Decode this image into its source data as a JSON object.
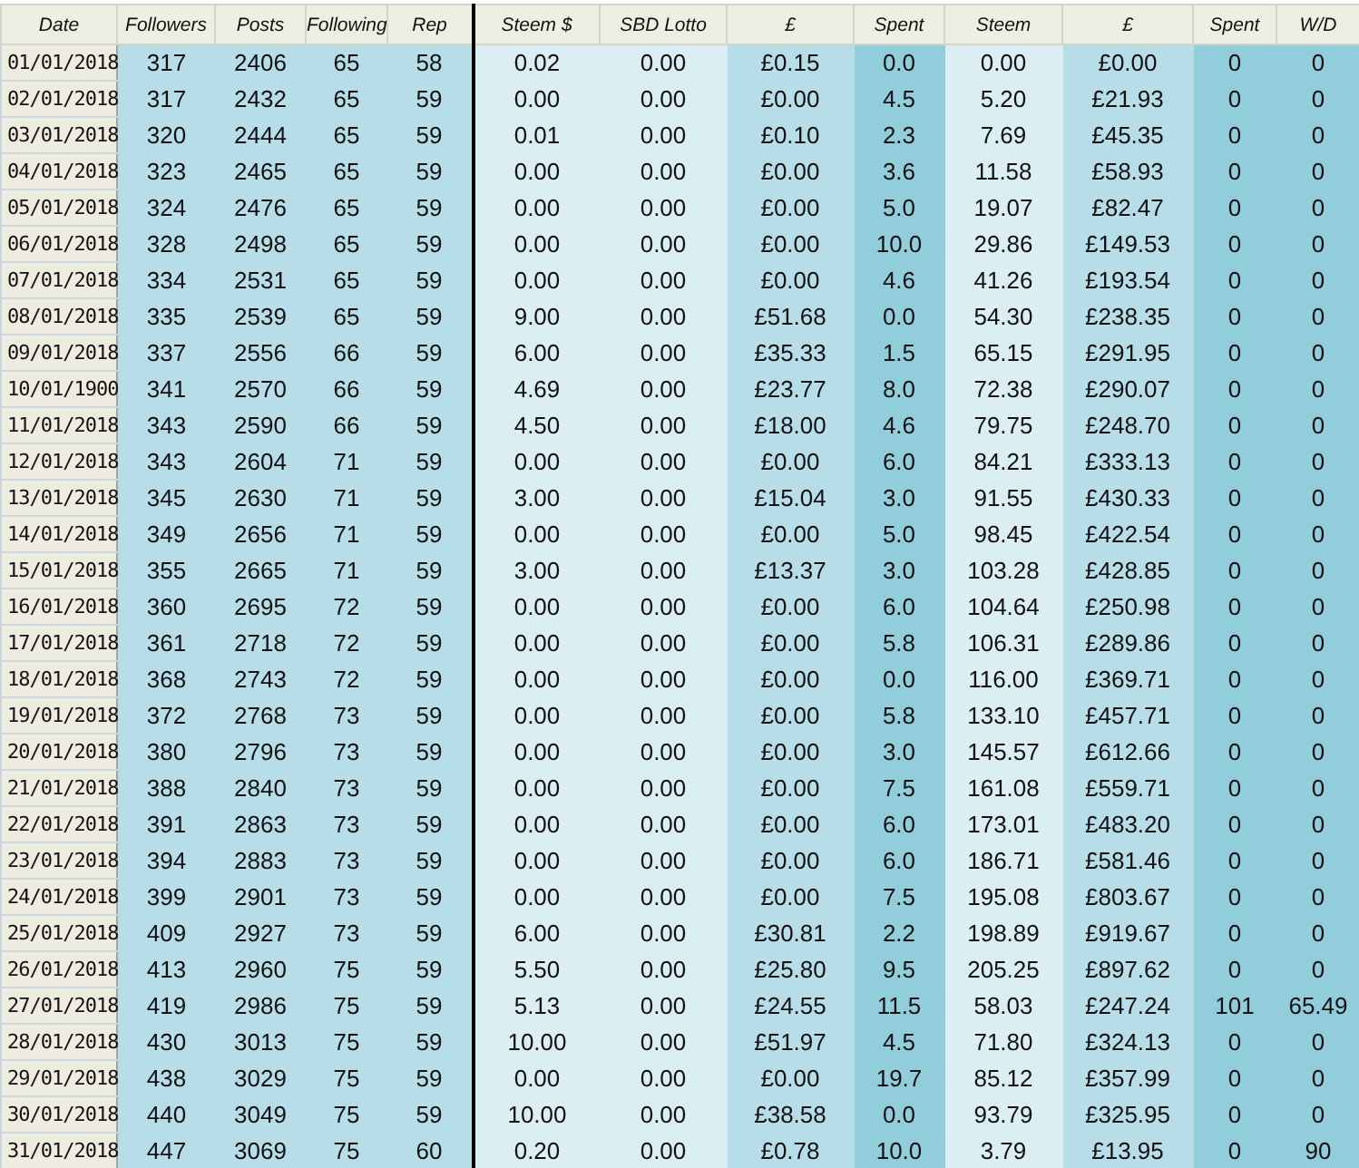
{
  "table": {
    "columns": [
      "Date",
      "Followers",
      "Posts",
      "Following",
      "Rep",
      "Steem $",
      "SBD Lotto",
      "£",
      "Spent",
      "Steem",
      "£",
      "Spent",
      "W/D"
    ],
    "rows": [
      [
        "01/01/2018",
        "317",
        "2406",
        "65",
        "58",
        "0.02",
        "0.00",
        "£0.15",
        "0.0",
        "0.00",
        "£0.00",
        "0",
        "0"
      ],
      [
        "02/01/2018",
        "317",
        "2432",
        "65",
        "59",
        "0.00",
        "0.00",
        "£0.00",
        "4.5",
        "5.20",
        "£21.93",
        "0",
        "0"
      ],
      [
        "03/01/2018",
        "320",
        "2444",
        "65",
        "59",
        "0.01",
        "0.00",
        "£0.10",
        "2.3",
        "7.69",
        "£45.35",
        "0",
        "0"
      ],
      [
        "04/01/2018",
        "323",
        "2465",
        "65",
        "59",
        "0.00",
        "0.00",
        "£0.00",
        "3.6",
        "11.58",
        "£58.93",
        "0",
        "0"
      ],
      [
        "05/01/2018",
        "324",
        "2476",
        "65",
        "59",
        "0.00",
        "0.00",
        "£0.00",
        "5.0",
        "19.07",
        "£82.47",
        "0",
        "0"
      ],
      [
        "06/01/2018",
        "328",
        "2498",
        "65",
        "59",
        "0.00",
        "0.00",
        "£0.00",
        "10.0",
        "29.86",
        "£149.53",
        "0",
        "0"
      ],
      [
        "07/01/2018",
        "334",
        "2531",
        "65",
        "59",
        "0.00",
        "0.00",
        "£0.00",
        "4.6",
        "41.26",
        "£193.54",
        "0",
        "0"
      ],
      [
        "08/01/2018",
        "335",
        "2539",
        "65",
        "59",
        "9.00",
        "0.00",
        "£51.68",
        "0.0",
        "54.30",
        "£238.35",
        "0",
        "0"
      ],
      [
        "09/01/2018",
        "337",
        "2556",
        "66",
        "59",
        "6.00",
        "0.00",
        "£35.33",
        "1.5",
        "65.15",
        "£291.95",
        "0",
        "0"
      ],
      [
        "10/01/1900",
        "341",
        "2570",
        "66",
        "59",
        "4.69",
        "0.00",
        "£23.77",
        "8.0",
        "72.38",
        "£290.07",
        "0",
        "0"
      ],
      [
        "11/01/2018",
        "343",
        "2590",
        "66",
        "59",
        "4.50",
        "0.00",
        "£18.00",
        "4.6",
        "79.75",
        "£248.70",
        "0",
        "0"
      ],
      [
        "12/01/2018",
        "343",
        "2604",
        "71",
        "59",
        "0.00",
        "0.00",
        "£0.00",
        "6.0",
        "84.21",
        "£333.13",
        "0",
        "0"
      ],
      [
        "13/01/2018",
        "345",
        "2630",
        "71",
        "59",
        "3.00",
        "0.00",
        "£15.04",
        "3.0",
        "91.55",
        "£430.33",
        "0",
        "0"
      ],
      [
        "14/01/2018",
        "349",
        "2656",
        "71",
        "59",
        "0.00",
        "0.00",
        "£0.00",
        "5.0",
        "98.45",
        "£422.54",
        "0",
        "0"
      ],
      [
        "15/01/2018",
        "355",
        "2665",
        "71",
        "59",
        "3.00",
        "0.00",
        "£13.37",
        "3.0",
        "103.28",
        "£428.85",
        "0",
        "0"
      ],
      [
        "16/01/2018",
        "360",
        "2695",
        "72",
        "59",
        "0.00",
        "0.00",
        "£0.00",
        "6.0",
        "104.64",
        "£250.98",
        "0",
        "0"
      ],
      [
        "17/01/2018",
        "361",
        "2718",
        "72",
        "59",
        "0.00",
        "0.00",
        "£0.00",
        "5.8",
        "106.31",
        "£289.86",
        "0",
        "0"
      ],
      [
        "18/01/2018",
        "368",
        "2743",
        "72",
        "59",
        "0.00",
        "0.00",
        "£0.00",
        "0.0",
        "116.00",
        "£369.71",
        "0",
        "0"
      ],
      [
        "19/01/2018",
        "372",
        "2768",
        "73",
        "59",
        "0.00",
        "0.00",
        "£0.00",
        "5.8",
        "133.10",
        "£457.71",
        "0",
        "0"
      ],
      [
        "20/01/2018",
        "380",
        "2796",
        "73",
        "59",
        "0.00",
        "0.00",
        "£0.00",
        "3.0",
        "145.57",
        "£612.66",
        "0",
        "0"
      ],
      [
        "21/01/2018",
        "388",
        "2840",
        "73",
        "59",
        "0.00",
        "0.00",
        "£0.00",
        "7.5",
        "161.08",
        "£559.71",
        "0",
        "0"
      ],
      [
        "22/01/2018",
        "391",
        "2863",
        "73",
        "59",
        "0.00",
        "0.00",
        "£0.00",
        "6.0",
        "173.01",
        "£483.20",
        "0",
        "0"
      ],
      [
        "23/01/2018",
        "394",
        "2883",
        "73",
        "59",
        "0.00",
        "0.00",
        "£0.00",
        "6.0",
        "186.71",
        "£581.46",
        "0",
        "0"
      ],
      [
        "24/01/2018",
        "399",
        "2901",
        "73",
        "59",
        "0.00",
        "0.00",
        "£0.00",
        "7.5",
        "195.08",
        "£803.67",
        "0",
        "0"
      ],
      [
        "25/01/2018",
        "409",
        "2927",
        "73",
        "59",
        "6.00",
        "0.00",
        "£30.81",
        "2.2",
        "198.89",
        "£919.67",
        "0",
        "0"
      ],
      [
        "26/01/2018",
        "413",
        "2960",
        "75",
        "59",
        "5.50",
        "0.00",
        "£25.80",
        "9.5",
        "205.25",
        "£897.62",
        "0",
        "0"
      ],
      [
        "27/01/2018",
        "419",
        "2986",
        "75",
        "59",
        "5.13",
        "0.00",
        "£24.55",
        "11.5",
        "58.03",
        "£247.24",
        "101",
        "65.49"
      ],
      [
        "28/01/2018",
        "430",
        "3013",
        "75",
        "59",
        "10.00",
        "0.00",
        "£51.97",
        "4.5",
        "71.80",
        "£324.13",
        "0",
        "0"
      ],
      [
        "29/01/2018",
        "438",
        "3029",
        "75",
        "59",
        "0.00",
        "0.00",
        "£0.00",
        "19.7",
        "85.12",
        "£357.99",
        "0",
        "0"
      ],
      [
        "30/01/2018",
        "440",
        "3049",
        "75",
        "59",
        "10.00",
        "0.00",
        "£38.58",
        "0.0",
        "93.79",
        "£325.95",
        "0",
        "0"
      ],
      [
        "31/01/2018",
        "447",
        "3069",
        "75",
        "60",
        "0.20",
        "0.00",
        "£0.78",
        "10.0",
        "3.79",
        "£13.95",
        "0",
        "90"
      ]
    ]
  }
}
